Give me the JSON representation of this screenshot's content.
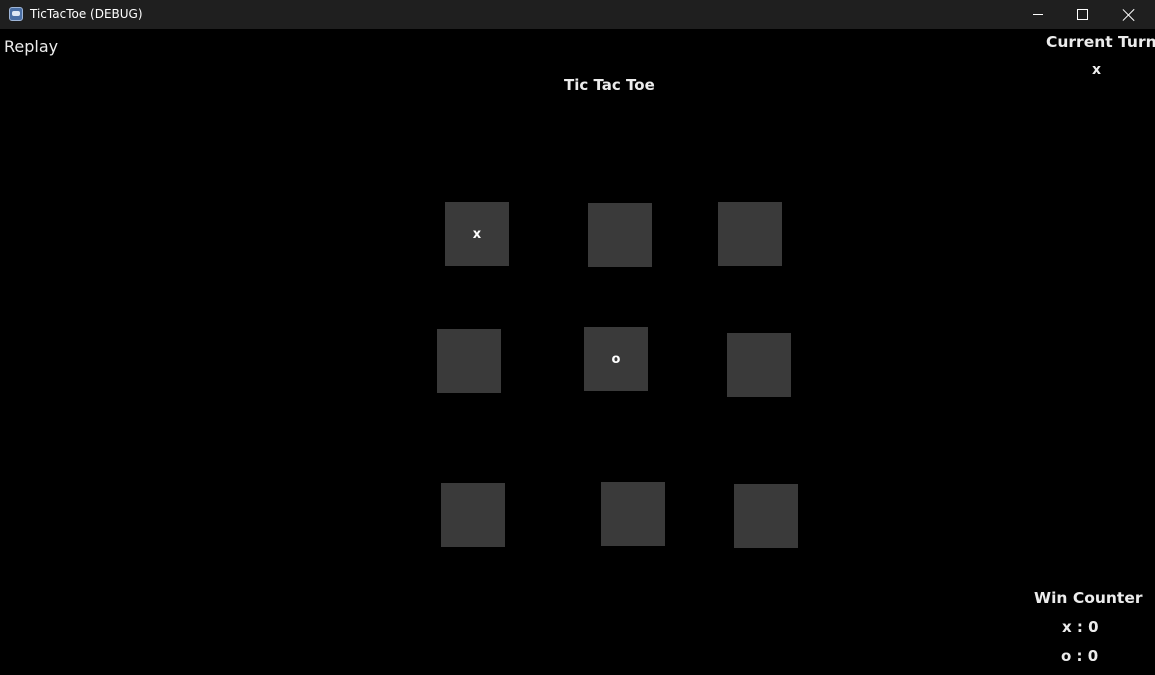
{
  "window": {
    "title": "TicTacToe (DEBUG)",
    "icon": "godot-engine-icon",
    "controls": [
      "minimize",
      "maximize",
      "close"
    ]
  },
  "game": {
    "replay_label": "Replay",
    "title": "Tic Tac Toe",
    "current_turn_label": "Current Turn",
    "current_turn_value": "x",
    "win_counter_label": "Win Counter",
    "score_x": "x : 0",
    "score_o": "o : 0"
  },
  "board": {
    "cells": [
      "x",
      "",
      "",
      "",
      "o",
      "",
      "",
      "",
      ""
    ]
  },
  "colors": {
    "background": "#000000",
    "cell": "#3a3a3a",
    "titlebar": "#1f1f1f",
    "text": "#ffffff"
  }
}
